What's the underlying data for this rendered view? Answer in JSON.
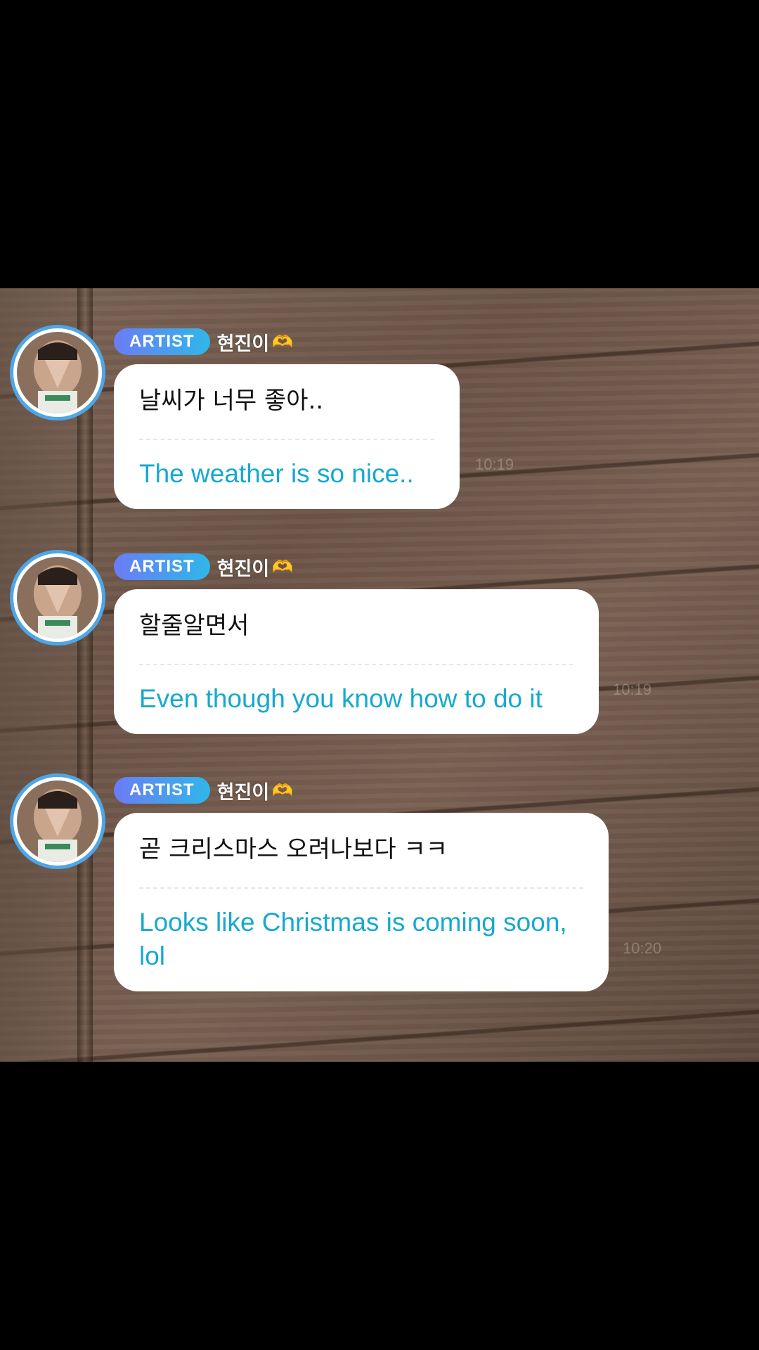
{
  "messages": [
    {
      "badge": "ARTIST",
      "name": "현진이",
      "name_emoji": "🫶",
      "original": "날씨가 너무 좋아..",
      "translation": "The weather is so nice..",
      "time": "10:19"
    },
    {
      "badge": "ARTIST",
      "name": "현진이",
      "name_emoji": "🫶",
      "original": "할줄알면서",
      "translation": "Even though you know how to do it",
      "time": "10:19"
    },
    {
      "badge": "ARTIST",
      "name": "현진이",
      "name_emoji": "🫶",
      "original": "곧 크리스마스 오려나보다 ㅋㅋ",
      "translation": "Looks like Christmas is coming soon, lol",
      "time": "10:20"
    }
  ],
  "colors": {
    "badge_start": "#6b7cf5",
    "badge_end": "#2fb7e8",
    "translation_text": "#16a9cf",
    "avatar_ring": "#4da6e8"
  },
  "icons": [
    "avatar",
    "heart-hands-icon"
  ]
}
